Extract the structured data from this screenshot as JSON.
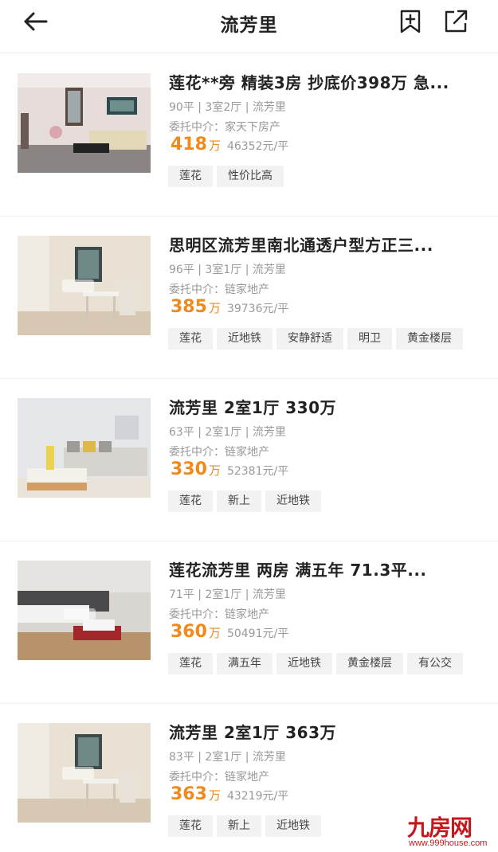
{
  "header": {
    "title": "流芳里",
    "back_icon": "arrow-left-icon",
    "bookmark_icon": "bookmark-add-icon",
    "share_icon": "share-external-icon"
  },
  "colors": {
    "price": "#f08a1c",
    "tag_bg": "#f2f2f2",
    "muted_text": "#999999",
    "watermark": "#c8161d"
  },
  "listings": [
    {
      "title": "莲花**旁 精装3房 抄底价398万 急...",
      "meta": "90平 | 3室2厅 | 流芳里",
      "agent": "委托中介：家天下房产",
      "price": "418",
      "price_unit": "万",
      "unit_price": "46352元/平",
      "tags": [
        "莲花",
        "性价比高"
      ]
    },
    {
      "title": "思明区流芳里南北通透户型方正三...",
      "meta": "96平 | 3室1厅 | 流芳里",
      "agent": "委托中介：链家地产",
      "price": "385",
      "price_unit": "万",
      "unit_price": "39736元/平",
      "tags": [
        "莲花",
        "近地铁",
        "安静舒适",
        "明卫",
        "黄金楼层"
      ]
    },
    {
      "title": "流芳里 2室1厅 330万",
      "meta": "63平 | 2室1厅 | 流芳里",
      "agent": "委托中介：链家地产",
      "price": "330",
      "price_unit": "万",
      "unit_price": "52381元/平",
      "tags": [
        "莲花",
        "新上",
        "近地铁"
      ]
    },
    {
      "title": "莲花流芳里  两房  满五年  71.3平...",
      "meta": "71平 | 2室1厅 | 流芳里",
      "agent": "委托中介：链家地产",
      "price": "360",
      "price_unit": "万",
      "unit_price": "50491元/平",
      "tags": [
        "莲花",
        "满五年",
        "近地铁",
        "黄金楼层",
        "有公交"
      ]
    },
    {
      "title": "流芳里 2室1厅 363万",
      "meta": "83平 | 2室1厅 | 流芳里",
      "agent": "委托中介：链家地产",
      "price": "363",
      "price_unit": "万",
      "unit_price": "43219元/平",
      "tags": [
        "莲花",
        "新上",
        "近地铁"
      ]
    }
  ],
  "watermark": {
    "brand": "九房网",
    "url": "www.999house.com"
  }
}
